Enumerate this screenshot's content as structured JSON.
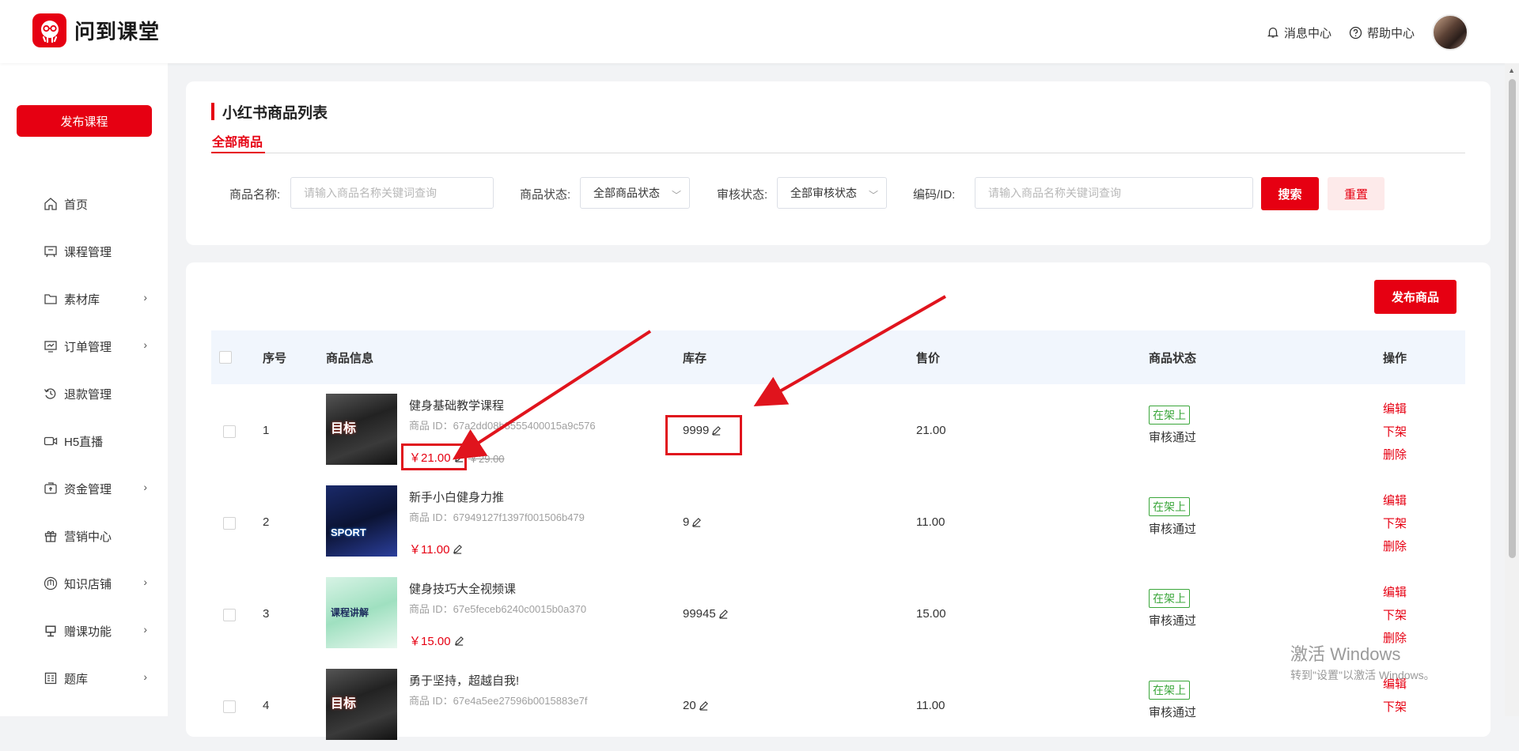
{
  "app": {
    "name": "问到课堂",
    "brand_color": "#e60012"
  },
  "header": {
    "messages": "消息中心",
    "help": "帮助中心"
  },
  "sidebar": {
    "publish": "发布课程",
    "items": [
      {
        "label": "首页",
        "icon": "home-icon",
        "has_children": false
      },
      {
        "label": "课程管理",
        "icon": "course-icon",
        "has_children": false
      },
      {
        "label": "素材库",
        "icon": "folder-icon",
        "has_children": true
      },
      {
        "label": "订单管理",
        "icon": "order-icon",
        "has_children": true
      },
      {
        "label": "退款管理",
        "icon": "refund-icon",
        "has_children": false
      },
      {
        "label": "H5直播",
        "icon": "live-icon",
        "has_children": false
      },
      {
        "label": "资金管理",
        "icon": "wallet-icon",
        "has_children": true
      },
      {
        "label": "营销中心",
        "icon": "gift-icon",
        "has_children": false
      },
      {
        "label": "知识店铺",
        "icon": "store-icon",
        "has_children": true
      },
      {
        "label": "赠课功能",
        "icon": "gift-course-icon",
        "has_children": true
      },
      {
        "label": "题库",
        "icon": "question-bank-icon",
        "has_children": true
      }
    ]
  },
  "page": {
    "title": "小红书商品列表",
    "tab": "全部商品"
  },
  "filters": {
    "name_label": "商品名称:",
    "name_placeholder": "请输入商品名称关键词查询",
    "status_label": "商品状态:",
    "status_value": "全部商品状态",
    "audit_label": "审核状态:",
    "audit_value": "全部审核状态",
    "code_label": "编码/ID:",
    "code_placeholder": "请输入商品名称关键词查询",
    "search": "搜索",
    "reset": "重置"
  },
  "table": {
    "publish_button": "发布商品",
    "headers": {
      "index": "序号",
      "info": "商品信息",
      "stock": "库存",
      "sale": "售价",
      "status": "商品状态",
      "ops": "操作"
    },
    "rows": [
      {
        "index": "1",
        "name": "健身基础教学课程",
        "id": "商品 ID：67a2dd08b8555400015a9c576",
        "price": "￥21.00",
        "orig_price": "￥29.00",
        "stock": "9999",
        "sale": "21.00",
        "status": "在架上",
        "audit": "审核通过",
        "thumb_text": "目标"
      },
      {
        "index": "2",
        "name": "新手小白健身力推",
        "id": "商品 ID：67949127f1397f001506b479",
        "price": "￥11.00",
        "orig_price": "",
        "stock": "9",
        "sale": "11.00",
        "status": "在架上",
        "audit": "审核通过",
        "thumb_text": "SPORT"
      },
      {
        "index": "3",
        "name": "健身技巧大全视频课",
        "id": "商品 ID：67e5feceb6240c0015b0a370",
        "price": "￥15.00",
        "orig_price": "",
        "stock": "99945",
        "sale": "15.00",
        "status": "在架上",
        "audit": "审核通过",
        "thumb_text": "课程讲解"
      },
      {
        "index": "4",
        "name": "勇于坚持，超越自我!",
        "id": "商品 ID：67e4a5ee27596b0015883e7f",
        "price": "",
        "orig_price": "",
        "stock": "20",
        "sale": "11.00",
        "status": "在架上",
        "audit": "审核通过",
        "thumb_text": "目标"
      }
    ],
    "ops": {
      "edit": "编辑",
      "off": "下架",
      "delete": "删除"
    }
  },
  "watermark": {
    "line1": "激活 Windows",
    "line2": "转到\"设置\"以激活 Windows。"
  }
}
